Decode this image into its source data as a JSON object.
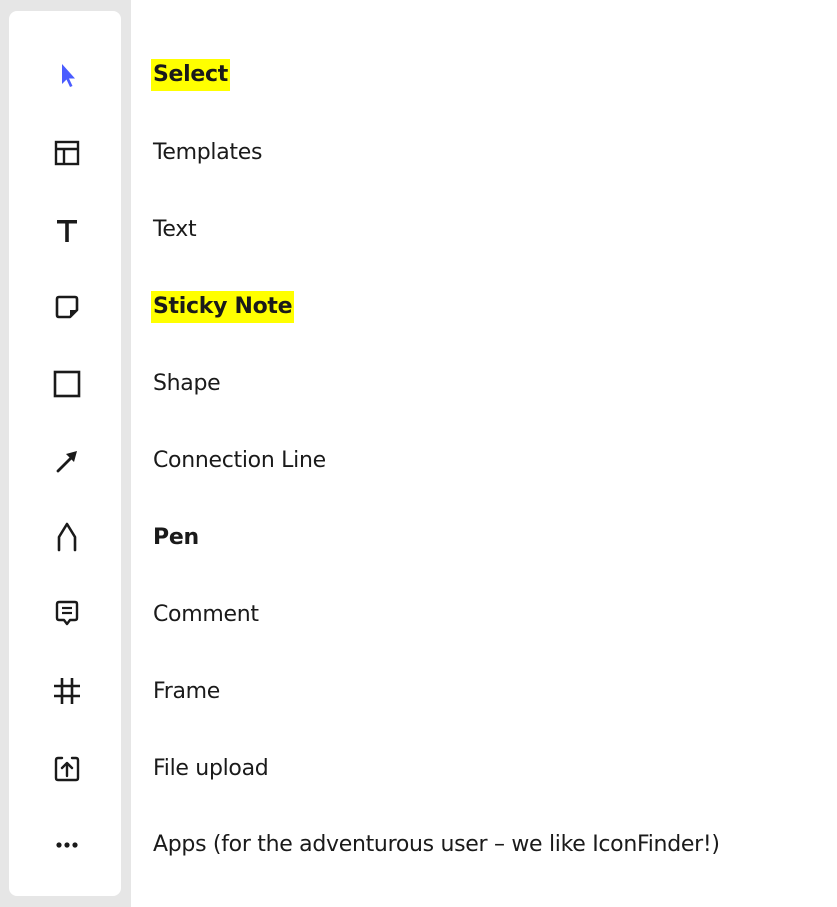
{
  "colors": {
    "select_accent": "#4a5cff",
    "icon": "#1a1a1a",
    "highlight": "#ffff00",
    "toolbar_border": "#e6e6e6"
  },
  "tools": [
    {
      "label": "Select",
      "icon": "cursor-arrow-icon",
      "bold": true,
      "highlight": true
    },
    {
      "label": "Templates",
      "icon": "templates-layout-icon",
      "bold": false,
      "highlight": false
    },
    {
      "label": "Text",
      "icon": "text-t-icon",
      "bold": false,
      "highlight": false
    },
    {
      "label": "Sticky Note",
      "icon": "sticky-note-icon",
      "bold": true,
      "highlight": true
    },
    {
      "label": "Shape",
      "icon": "square-shape-icon",
      "bold": false,
      "highlight": false
    },
    {
      "label": "Connection Line",
      "icon": "arrow-line-icon",
      "bold": false,
      "highlight": false
    },
    {
      "label": "Pen",
      "icon": "pen-icon",
      "bold": true,
      "highlight": false
    },
    {
      "label": "Comment",
      "icon": "comment-icon",
      "bold": false,
      "highlight": false
    },
    {
      "label": "Frame",
      "icon": "frame-icon",
      "bold": false,
      "highlight": false
    },
    {
      "label": "File upload",
      "icon": "file-upload-icon",
      "bold": false,
      "highlight": false
    },
    {
      "label": "Apps (for the adventurous user – we like IconFinder!)",
      "icon": "more-dots-icon",
      "bold": false,
      "highlight": false
    }
  ]
}
